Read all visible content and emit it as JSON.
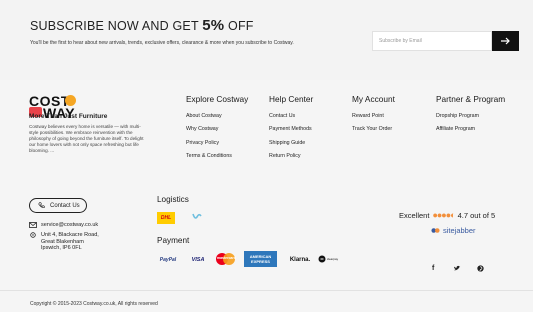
{
  "subscribe": {
    "title_prefix": "SUBSCRIBE NOW AND GET ",
    "title_pct": "5%",
    "title_suffix": " OFF",
    "description": "You'll be the first to hear about new arrivals, trends, exclusive offers, clearance & more when you subscribe to Costway.",
    "email_placeholder": "Subscribe by Email",
    "submit_icon": "arrow-right-icon"
  },
  "brand": {
    "logo_line1": "COST",
    "logo_line2": "WAY",
    "tagline": "More Than Just Furniture",
    "description": "Costway believes every home is versatile — with multi-style possibilities. We embrace reinvention with the philosophy of going beyond the furniture itself. To delight our home lovers with not only space refreshing but life blooming. ..."
  },
  "columns": [
    {
      "title": "Explore Costway",
      "links": [
        "About Costway",
        "Why Costway",
        "Privacy Policy",
        "Terms & Conditions"
      ]
    },
    {
      "title": "Help Center",
      "links": [
        "Contact Us",
        "Payment Methods",
        "Shipping Guide",
        "Return Policy"
      ]
    },
    {
      "title": "My Account",
      "links": [
        "Reward Point",
        "Track Your Order"
      ]
    },
    {
      "title": "Partner & Program",
      "links": [
        "Dropship Program",
        "Affiliate Program"
      ]
    }
  ],
  "contact": {
    "button_label": "Contact Us",
    "email": "service@costway.co.uk",
    "address_line1": "Unit 4, Blackacre Road,",
    "address_line2": "Great Blakenham",
    "address_line3": "Ipswich, IP6 0FL"
  },
  "logistics": {
    "title": "Logistics",
    "carriers": [
      "DHL",
      "yodel"
    ]
  },
  "payment": {
    "title": "Payment",
    "methods": [
      "PayPal",
      "VISA",
      "mastercard",
      "AMERICAN EXPRESS",
      "Klarna.",
      "clearpay"
    ]
  },
  "rating": {
    "label": "Excellent",
    "score_text": "4.7 out of 5",
    "stars": 4.7,
    "provider": "sitejabber"
  },
  "social": [
    "f",
    "twitter",
    "pinterest"
  ],
  "footer": {
    "copyright": "Copyright © 2015-2023 Costway.co.uk, All rights reserved"
  },
  "colors": {
    "accent_orange": "#f5a623",
    "logo_red": "#e8434a",
    "star_orange": "#f28f3b",
    "button_dark": "#111111"
  }
}
